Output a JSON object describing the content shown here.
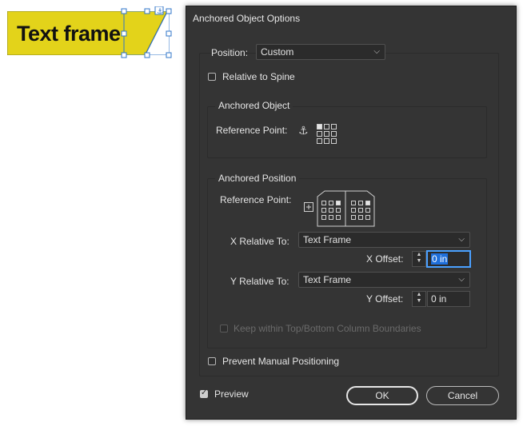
{
  "canvas": {
    "frame_text": "Text frame",
    "frame_color": "#e3d31a"
  },
  "dialog": {
    "title": "Anchored Object Options",
    "position_label": "Position:",
    "position_value": "Custom",
    "relative_to_spine": "Relative to Spine",
    "anchored_object": {
      "legend": "Anchored Object",
      "reference_point_label": "Reference Point:"
    },
    "anchored_position": {
      "legend": "Anchored Position",
      "reference_point_label": "Reference Point:",
      "x_relative_label": "X Relative To:",
      "x_relative_value": "Text Frame",
      "x_offset_label": "X Offset:",
      "x_offset_value": "0 in",
      "y_relative_label": "Y Relative To:",
      "y_relative_value": "Text Frame",
      "y_offset_label": "Y Offset:",
      "y_offset_value": "0 in",
      "keep_within_label": "Keep within Top/Bottom Column Boundaries"
    },
    "prevent_manual_positioning": "Prevent Manual Positioning",
    "preview_label": "Preview",
    "ok_label": "OK",
    "cancel_label": "Cancel",
    "accent_color": "#1f6fdb"
  }
}
